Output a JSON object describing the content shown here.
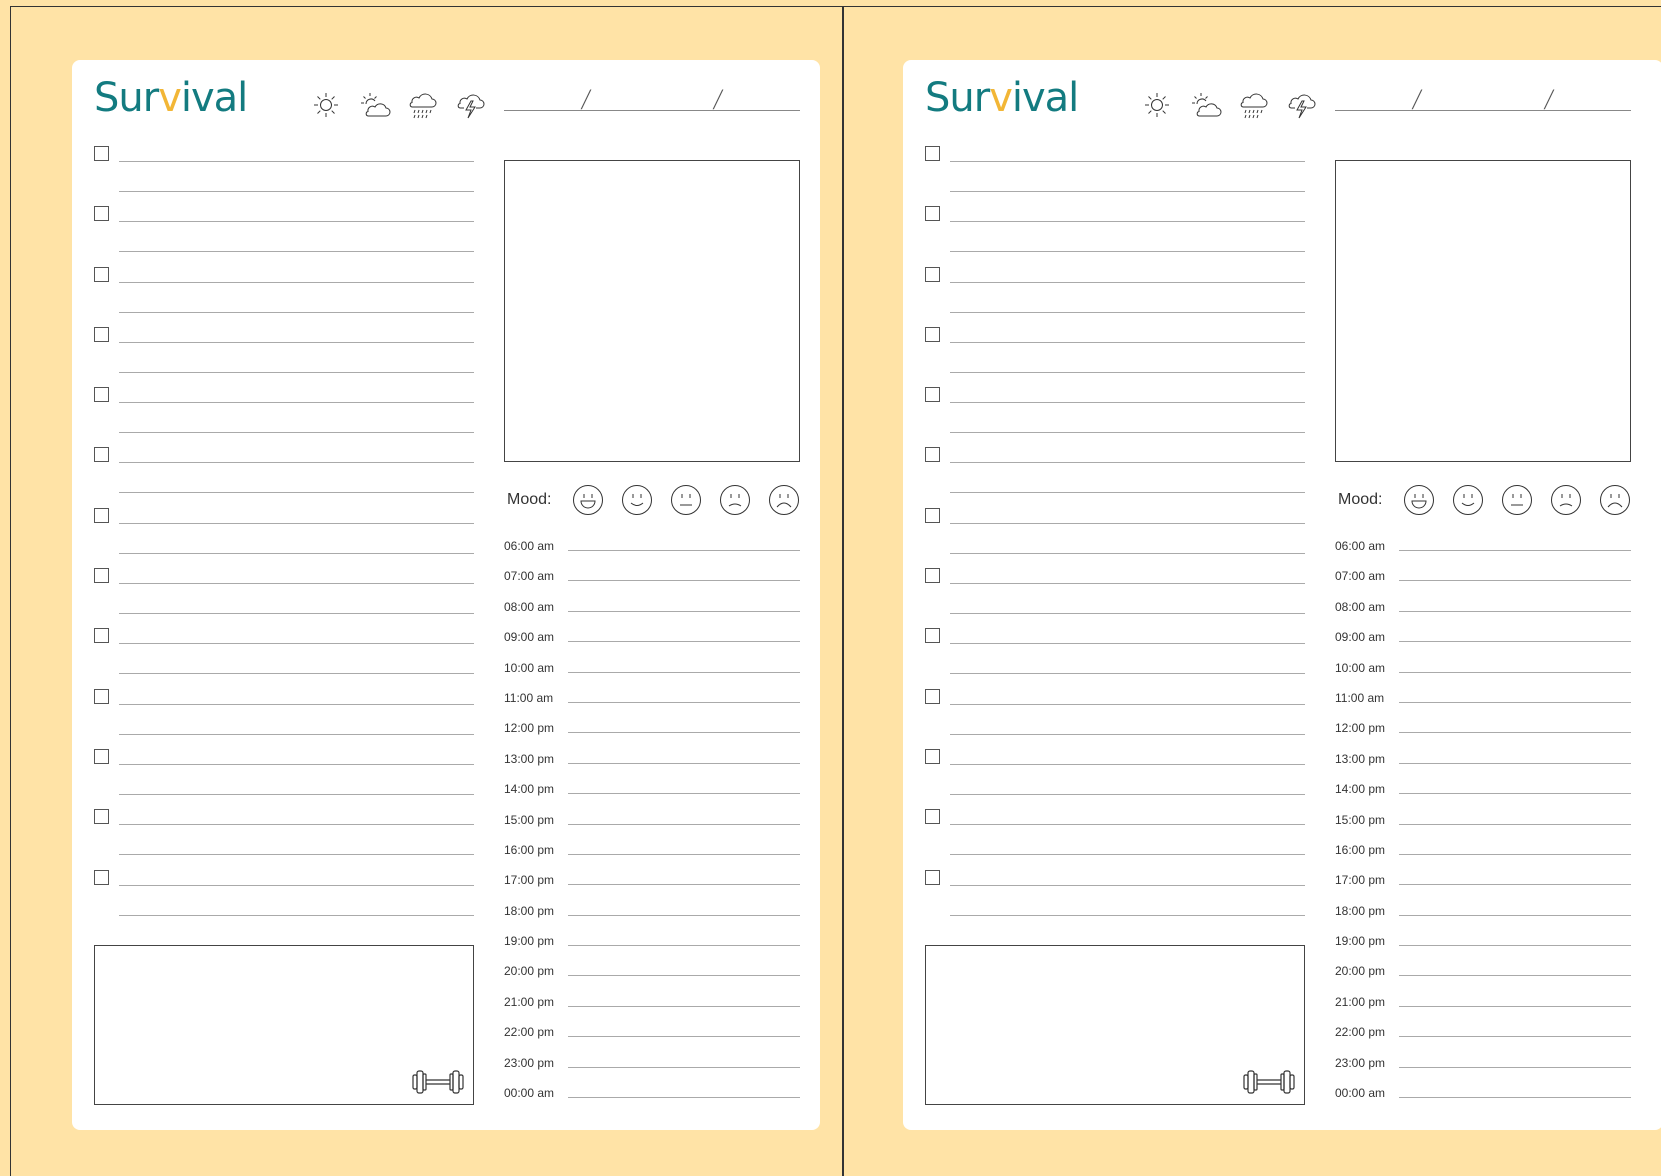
{
  "brand": {
    "name_before": "Sur",
    "name_accent": "v",
    "name_after": "ival",
    "color": "#137b80",
    "accent_color": "#f2b636"
  },
  "weather_icons": [
    "sun-icon",
    "partly-cloudy-icon",
    "rain-icon",
    "thunderstorm-icon"
  ],
  "date": {
    "separator": "/"
  },
  "mood": {
    "label": "Mood:",
    "faces": [
      "very-happy-face-icon",
      "happy-face-icon",
      "neutral-face-icon",
      "sad-face-icon",
      "very-sad-face-icon"
    ]
  },
  "task_count": 13,
  "schedule": [
    "06:00 am",
    "07:00 am",
    "08:00 am",
    "09:00 am",
    "10:00 am",
    "11:00 am",
    "12:00 pm",
    "13:00 pm",
    "14:00 pm",
    "15:00 pm",
    "16:00 pm",
    "17:00 pm",
    "18:00 pm",
    "19:00 pm",
    "20:00 pm",
    "21:00 pm",
    "22:00 pm",
    "23:00 pm",
    "00:00 am"
  ],
  "workout_icon": "dumbbell-icon",
  "colors": {
    "background": "#ffe3a6",
    "page": "#ffffff",
    "line": "#aaaaaa"
  }
}
